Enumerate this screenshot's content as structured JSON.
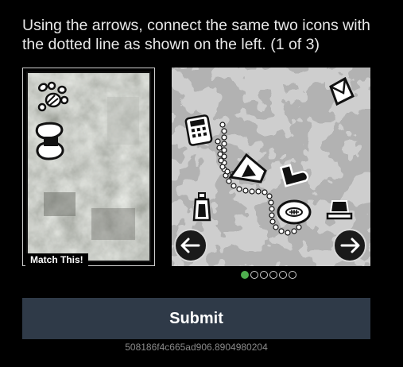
{
  "instructions": "Using the arrows, connect the same two icons with the dotted line as shown on the left. (1 of 3)",
  "reference": {
    "label": "Match This!",
    "icons": [
      "pawprint-icon",
      "bandage-icon"
    ]
  },
  "puzzle": {
    "icons": [
      "calculator-icon",
      "tent-icon",
      "boot-icon",
      "football-icon",
      "envelope-icon",
      "lantern-icon",
      "hat-icon"
    ],
    "page_dots": 6,
    "active_dot": 0,
    "left_arrow_icon": "arrow-left-icon",
    "right_arrow_icon": "arrow-right-icon"
  },
  "submit_label": "Submit",
  "token": "508186f4c665ad906.8904980204",
  "colors": {
    "background": "#000000",
    "submit_bg": "#2f3a48",
    "active_dot": "#4fae4f",
    "text": "#e9e9e9",
    "token_text": "#8a8a8a"
  }
}
